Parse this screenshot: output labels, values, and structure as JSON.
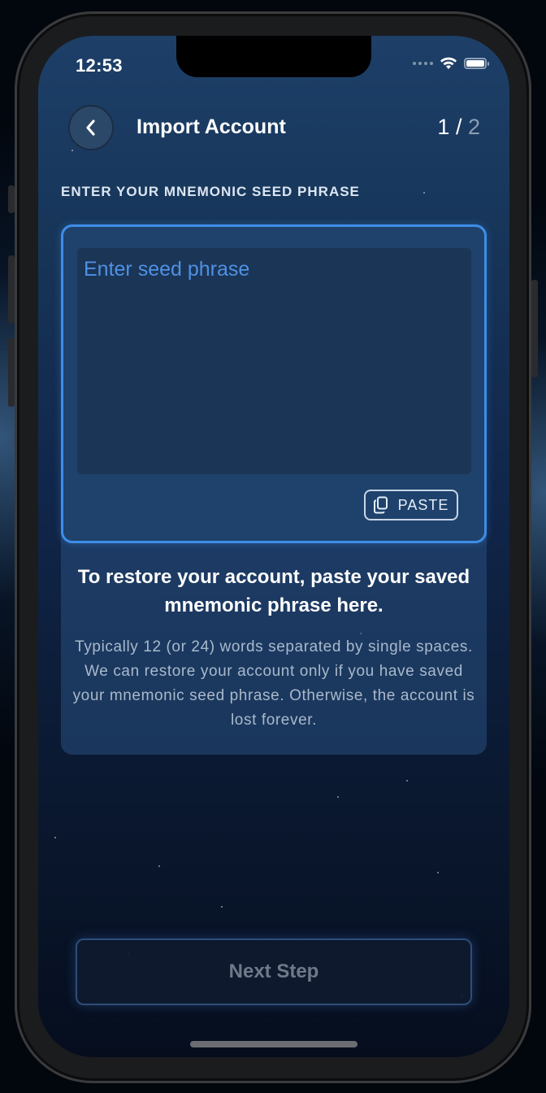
{
  "status_bar": {
    "time": "12:53",
    "icons": [
      "signal-dots-icon",
      "wifi-icon",
      "battery-icon"
    ]
  },
  "header": {
    "back_icon": "chevron-left-icon",
    "title": "Import Account",
    "step_current": "1",
    "step_separator": " / ",
    "step_total": "2"
  },
  "section": {
    "label": "ENTER YOUR MNEMONIC SEED PHRASE"
  },
  "seed_input": {
    "value": "",
    "placeholder": "Enter seed phrase"
  },
  "paste_button": {
    "icon": "copy-icon",
    "label": "PASTE"
  },
  "info": {
    "headline": "To restore your account, paste your saved mnemonic phrase here.",
    "body": "Typically 12 (or 24) words separated by single spaces. We can restore your account only if you have saved your mnemonic seed phrase. Otherwise, the account is lost forever."
  },
  "footer": {
    "next_label": "Next Step"
  },
  "colors": {
    "accent": "#3e8de8",
    "placeholder": "#4f91e3",
    "background_top": "#1d3f68",
    "background_bottom": "#060e1e"
  }
}
